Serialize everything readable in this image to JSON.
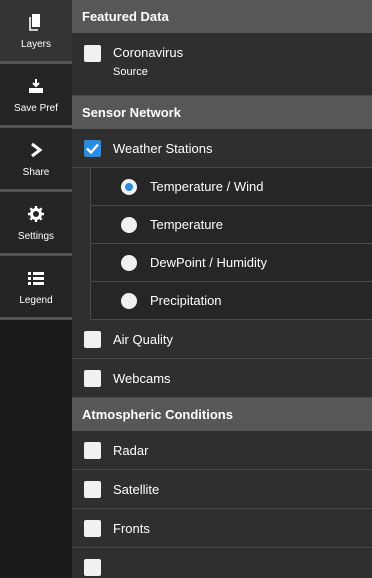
{
  "sidebar": {
    "items": [
      {
        "label": "Layers",
        "icon": "layers-icon"
      },
      {
        "label": "Save Pref",
        "icon": "save-icon"
      },
      {
        "label": "Share",
        "icon": "share-icon"
      },
      {
        "label": "Settings",
        "icon": "settings-gear-icon"
      },
      {
        "label": "Legend",
        "icon": "legend-list-icon"
      }
    ]
  },
  "featured": {
    "header": "Featured Data",
    "coronavirus_label": "Coronavirus",
    "source_label": "Source"
  },
  "sensor": {
    "header": "Sensor Network",
    "weather_label": "Weather Stations",
    "options": [
      "Temperature / Wind",
      "Temperature",
      "DewPoint / Humidity",
      "Precipitation"
    ],
    "selected_option": "Temperature / Wind",
    "air_quality_label": "Air Quality",
    "webcams_label": "Webcams"
  },
  "atmospheric": {
    "header": "Atmospheric Conditions",
    "radar_label": "Radar",
    "satellite_label": "Satellite",
    "fronts_label": "Fronts"
  },
  "colors": {
    "accent": "#2b8be1",
    "header_bg": "#575757",
    "panel_bg": "#2f2f2f"
  }
}
